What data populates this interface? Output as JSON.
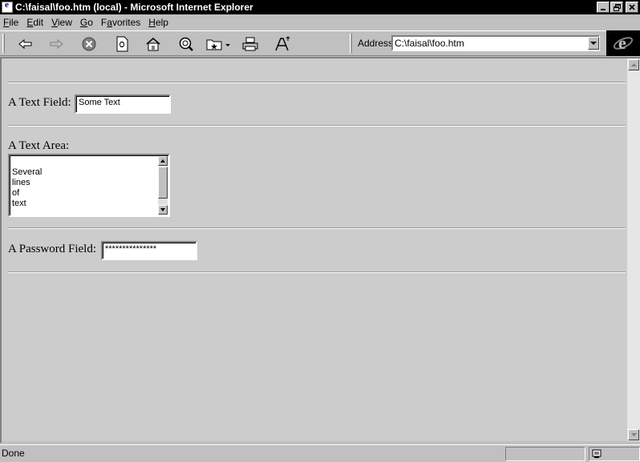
{
  "window": {
    "title": "C:\\faisal\\foo.htm (local) - Microsoft Internet Explorer",
    "controls": [
      "minimize",
      "restore",
      "close"
    ]
  },
  "menu": [
    {
      "label": "File",
      "accel": "F",
      "rest": "ile"
    },
    {
      "label": "Edit",
      "accel": "E",
      "rest": "dit"
    },
    {
      "label": "View",
      "accel": "V",
      "rest": "iew"
    },
    {
      "label": "Go",
      "accel": "G",
      "rest": "o"
    },
    {
      "label": "Favorites",
      "accel": "a",
      "pre": "F",
      "rest": "vorites"
    },
    {
      "label": "Help",
      "accel": "H",
      "rest": "elp"
    }
  ],
  "toolbar": {
    "buttons": [
      "back-icon",
      "forward-icon",
      "stop-icon",
      "refresh-icon",
      "home-icon",
      "search-icon",
      "favorites-icon",
      "print-icon",
      "font-icon"
    ],
    "address_label": "Address",
    "address_value": "C:\\faisal\\foo.htm"
  },
  "form": {
    "text_field_label": "A Text Field:",
    "text_field_value": "Some Text",
    "text_area_label": "A Text Area:",
    "text_area_lines": [
      "Several",
      "lines",
      "of",
      "text"
    ],
    "password_label": "A Password Field:",
    "password_value": "***************"
  },
  "status": {
    "text": "Done",
    "zone_icon": "computer-icon"
  }
}
